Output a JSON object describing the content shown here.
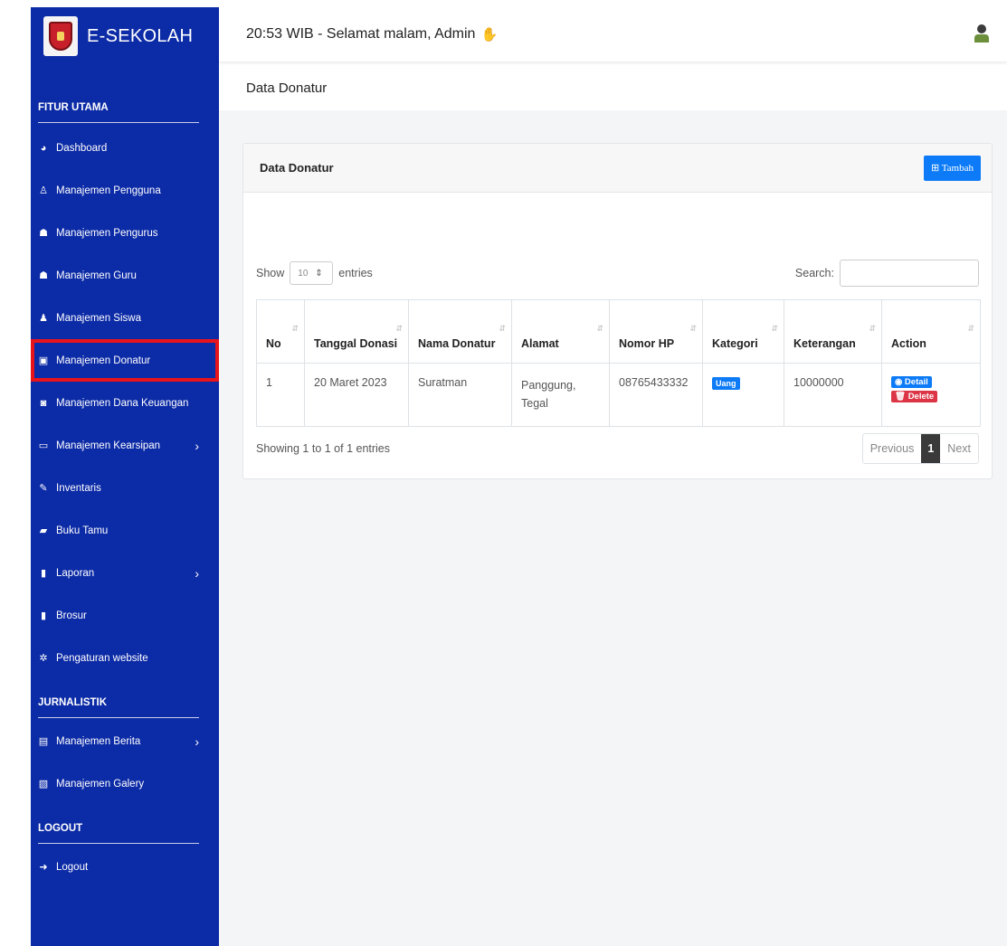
{
  "brand": {
    "name": "E-SEKOLAH"
  },
  "header": {
    "greeting": "20:53 WIB - Selamat malam, Admin"
  },
  "page_header": {
    "title": "Data Donatur"
  },
  "sidebar": {
    "sections": [
      {
        "title": "FITUR UTAMA",
        "items": [
          {
            "label": "Dashboard",
            "icon": "tachometer-icon"
          },
          {
            "label": "Manajemen Pengguna",
            "icon": "user-icon"
          },
          {
            "label": "Manajemen Pengurus",
            "icon": "users-icon"
          },
          {
            "label": "Manajemen Guru",
            "icon": "users-icon"
          },
          {
            "label": "Manajemen Siswa",
            "icon": "student-icon"
          },
          {
            "label": "Manajemen Donatur",
            "icon": "id-card-icon",
            "active": true
          },
          {
            "label": "Manajemen Dana Keuangan",
            "icon": "money-icon"
          },
          {
            "label": "Manajemen Kearsipan",
            "icon": "folder-icon",
            "chevron": true
          },
          {
            "label": "Inventaris",
            "icon": "edit-icon"
          },
          {
            "label": "Buku Tamu",
            "icon": "book-icon"
          },
          {
            "label": "Laporan",
            "icon": "file-icon",
            "chevron": true
          },
          {
            "label": "Brosur",
            "icon": "file-icon"
          },
          {
            "label": "Pengaturan website",
            "icon": "gear-icon"
          }
        ]
      },
      {
        "title": "JURNALISTIK",
        "items": [
          {
            "label": "Manajemen Berita",
            "icon": "newspaper-icon",
            "chevron": true
          },
          {
            "label": "Manajemen Galery",
            "icon": "image-icon"
          }
        ]
      },
      {
        "title": "LOGOUT",
        "items": [
          {
            "label": "Logout",
            "icon": "sign-out-icon"
          }
        ]
      }
    ]
  },
  "card": {
    "title": "Data Donatur",
    "add_button": "⊞ Tambah"
  },
  "table_controls": {
    "show_label": "Show",
    "entries_value": "10",
    "entries_label": "entries",
    "search_label": "Search:"
  },
  "table": {
    "columns": [
      "No",
      "Tanggal Donasi",
      "Nama Donatur",
      "Alamat",
      "Nomor HP",
      "Kategori",
      "Keterangan",
      "Action"
    ],
    "rows": [
      {
        "no": "1",
        "tanggal": "20 Maret 2023",
        "nama": "Suratman",
        "alamat": "Panggung, Tegal",
        "hp": "08765433332",
        "kategori": "Uang",
        "keterangan": "10000000",
        "detail_label": "◉ Detail",
        "delete_label": "🗑 Delete"
      }
    ]
  },
  "pagination": {
    "info": "Showing 1 to 1 of 1 entries",
    "previous": "Previous",
    "current": "1",
    "next": "Next"
  },
  "colors": {
    "sidebar_bg": "#0c2ba6",
    "primary": "#0d7bf7",
    "danger": "#dc3545",
    "active_outline": "#e8141c"
  }
}
